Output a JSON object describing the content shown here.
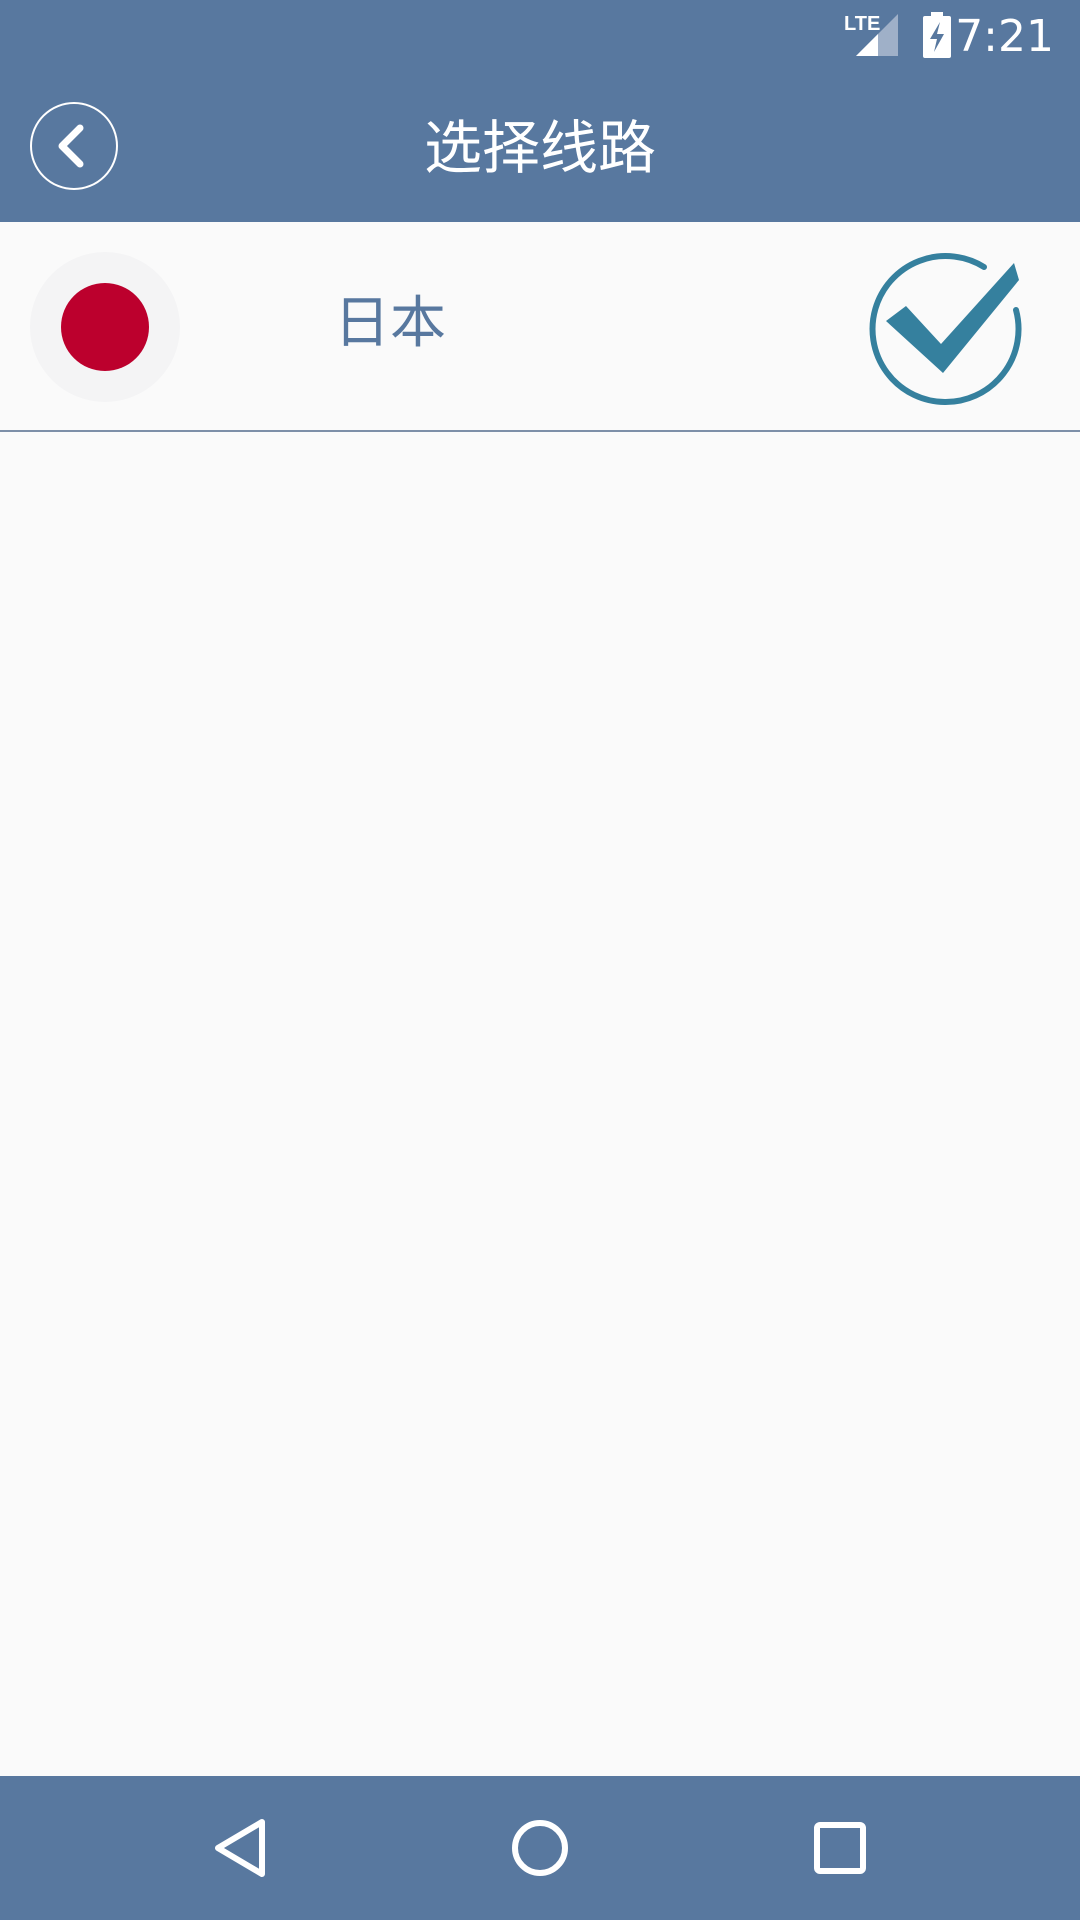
{
  "status_bar": {
    "network": "LTE",
    "time": "7:21",
    "icons": [
      "lte-signal-icon",
      "battery-charging-icon"
    ]
  },
  "app_bar": {
    "title": "选择线路",
    "back_icon": "chevron-left-icon"
  },
  "routes": [
    {
      "label": "日本",
      "flag": "japan-flag-icon",
      "selected": true,
      "selected_icon": "check-circle-icon"
    }
  ],
  "nav_bar": {
    "buttons": [
      "back-triangle-icon",
      "home-circle-icon",
      "recents-square-icon"
    ]
  },
  "colors": {
    "primary": "#58789f",
    "background": "#fafafa",
    "check": "#35809e",
    "flag_red": "#bc002d"
  }
}
